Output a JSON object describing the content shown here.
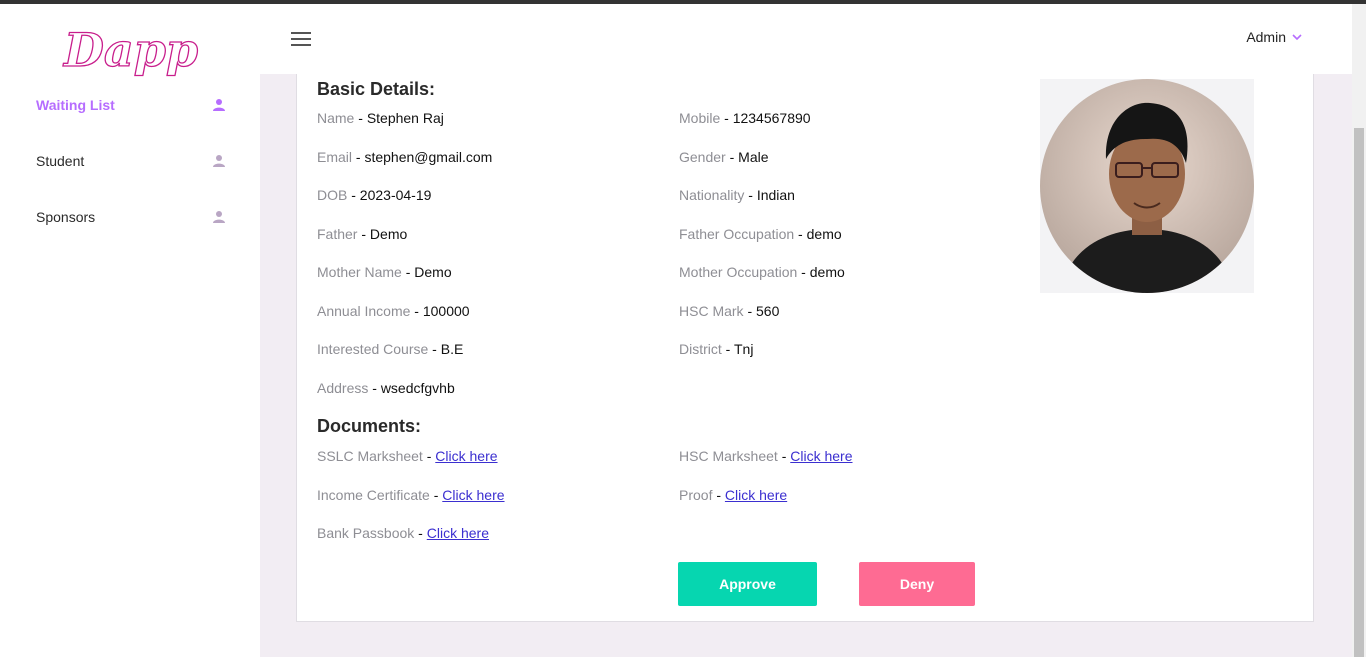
{
  "app": {
    "logo_text": "Dapp"
  },
  "header": {
    "user_label": "Admin"
  },
  "sidebar": {
    "items": [
      {
        "label": "Waiting List",
        "active": true
      },
      {
        "label": "Student",
        "active": false
      },
      {
        "label": "Sponsors",
        "active": false
      }
    ]
  },
  "basic": {
    "title": "Basic Details:",
    "fields": [
      {
        "label": "Name",
        "value": "Stephen Raj"
      },
      {
        "label": "Mobile",
        "value": "1234567890"
      },
      {
        "label": "Email",
        "value": "stephen@gmail.com"
      },
      {
        "label": "Gender",
        "value": "Male"
      },
      {
        "label": "DOB",
        "value": "2023-04-19"
      },
      {
        "label": "Nationality",
        "value": "Indian"
      },
      {
        "label": "Father",
        "value": "Demo"
      },
      {
        "label": "Father Occupation",
        "value": "demo"
      },
      {
        "label": "Mother Name",
        "value": "Demo"
      },
      {
        "label": "Mother Occupation",
        "value": "demo"
      },
      {
        "label": "Annual Income",
        "value": "100000"
      },
      {
        "label": "HSC Mark",
        "value": "560"
      },
      {
        "label": "Interested Course",
        "value": "B.E"
      },
      {
        "label": "District",
        "value": "Tnj"
      },
      {
        "label": "Address",
        "value": "wsedcfgvhb"
      }
    ]
  },
  "documents": {
    "title": "Documents:",
    "items": [
      {
        "label": "SSLC Marksheet",
        "link": "Click here"
      },
      {
        "label": "HSC Marksheet",
        "link": "Click here"
      },
      {
        "label": "Income Certificate",
        "link": "Click here"
      },
      {
        "label": "Proof",
        "link": "Click here"
      },
      {
        "label": "Bank Passbook",
        "link": "Click here"
      }
    ]
  },
  "actions": {
    "approve": "Approve",
    "deny": "Deny"
  },
  "colors": {
    "accent": "#b66dff",
    "approve": "#06d6b0",
    "deny": "#fe6b93"
  }
}
